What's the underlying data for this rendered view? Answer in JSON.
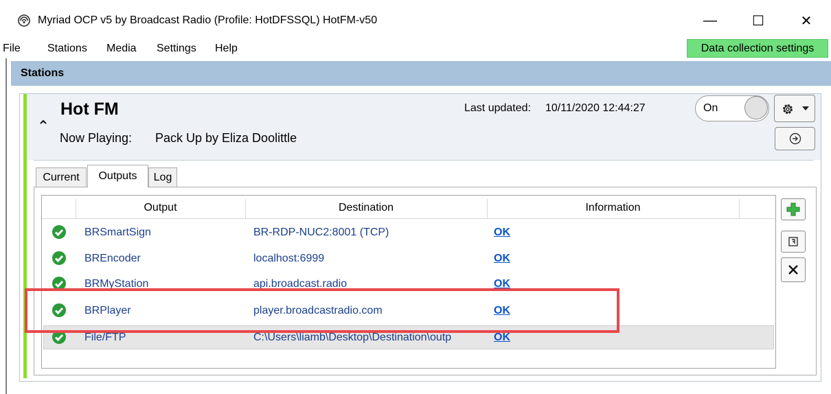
{
  "window": {
    "title": "Myriad OCP v5 by Broadcast Radio (Profile: HotDFSSQL) HotFM-v50",
    "minimize_glyph": "—",
    "maximize_glyph": "☐",
    "close_glyph": "✕"
  },
  "menu": {
    "items": [
      {
        "label": "File"
      },
      {
        "label": "Stations"
      },
      {
        "label": "Media"
      },
      {
        "label": "Settings"
      },
      {
        "label": "Help"
      }
    ],
    "data_collection": "Data collection settings"
  },
  "panel": {
    "title": "Stations"
  },
  "station": {
    "name": "Hot FM",
    "now_playing_label": "Now Playing:",
    "now_playing_value": "Pack Up by Eliza Doolittle",
    "last_updated_label": "Last updated:",
    "last_updated_value": "10/11/2020 12:44:27",
    "toggle_label": "On"
  },
  "tabs": [
    {
      "label": "Current"
    },
    {
      "label": "Outputs",
      "active": true
    },
    {
      "label": "Log"
    }
  ],
  "grid": {
    "columns": [
      "Output",
      "Destination",
      "Information"
    ],
    "rows": [
      {
        "output": "BRSmartSign",
        "destination": "BR-RDP-NUC2:8001 (TCP)",
        "info": "OK"
      },
      {
        "output": "BREncoder",
        "destination": "localhost:6999",
        "info": "OK"
      },
      {
        "output": "BRMyStation",
        "destination": "api.broadcast.radio",
        "info": "OK"
      },
      {
        "output": "BRPlayer",
        "destination": "player.broadcastradio.com",
        "info": "OK"
      },
      {
        "output": "File/FTP",
        "destination": "C:\\Users\\liamb\\Desktop\\Destination\\outp",
        "info": "OK",
        "selected": true
      }
    ]
  },
  "colors": {
    "accent_green": "#8ddd2a",
    "header_blue": "#a7c2da",
    "highlight_red": "#e8484c",
    "data_collection_green": "#6fe07d"
  }
}
